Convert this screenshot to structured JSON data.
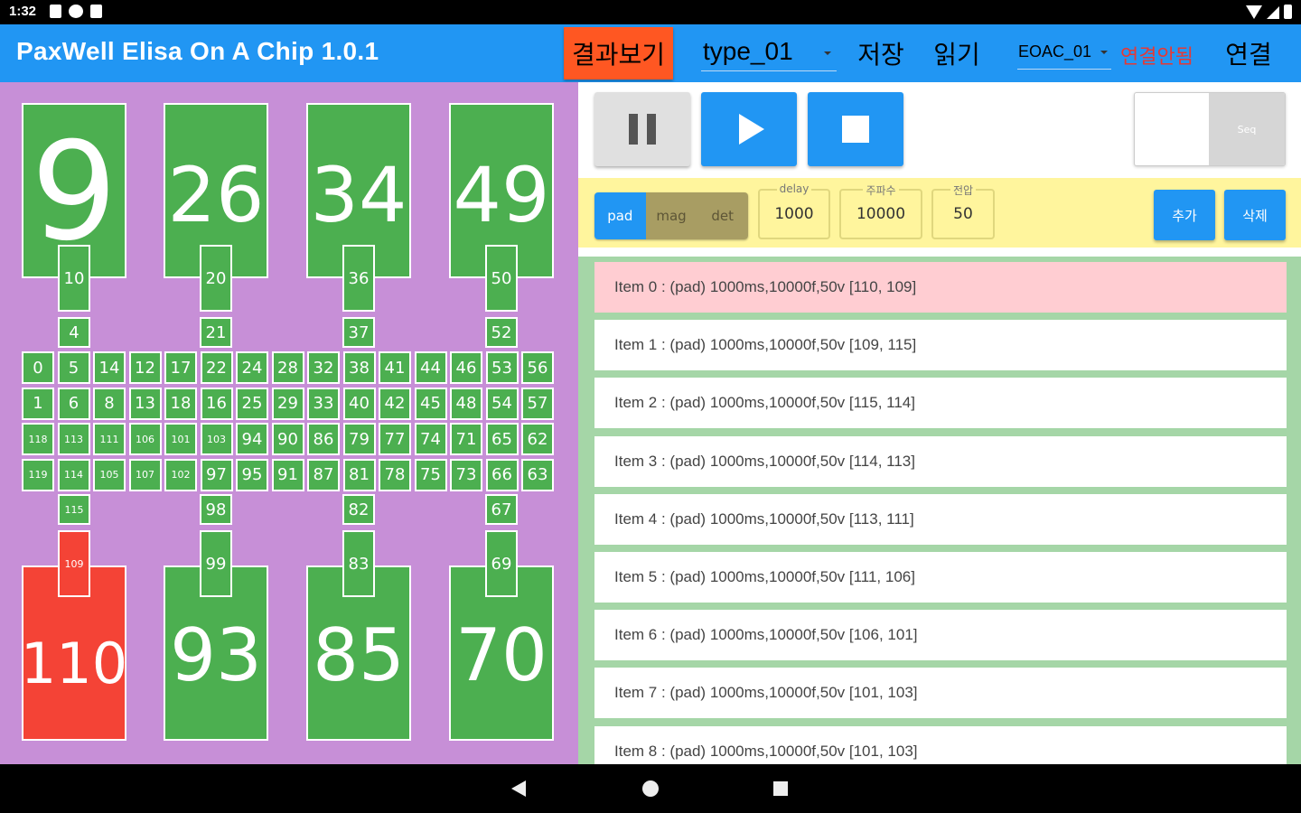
{
  "status_bar": {
    "time": "1:32"
  },
  "app_bar": {
    "title": "PaxWell Elisa On A Chip 1.0.1",
    "result_button": "결과보기",
    "type_value": "type_01",
    "save_button": "저장",
    "read_button": "읽기",
    "device_value": "EOAC_01",
    "connection_status": "연결안됨",
    "connect_button": "연결"
  },
  "chip": {
    "top_pads": [
      {
        "label": "9",
        "state": "on"
      },
      {
        "label": "26",
        "state": "on"
      },
      {
        "label": "34",
        "state": "on"
      },
      {
        "label": "49",
        "state": "on"
      }
    ],
    "bottom_pads": [
      {
        "label": "110",
        "state": "active"
      },
      {
        "label": "93",
        "state": "on"
      },
      {
        "label": "85",
        "state": "on"
      },
      {
        "label": "70",
        "state": "on"
      }
    ],
    "top_connectors": [
      [
        "10",
        "4"
      ],
      [
        "20",
        "21"
      ],
      [
        "36",
        "37"
      ],
      [
        "50",
        "52"
      ]
    ],
    "bottom_connectors": [
      [
        "115",
        "109"
      ],
      [
        "98",
        "99"
      ],
      [
        "82",
        "83"
      ],
      [
        "67",
        "69"
      ]
    ],
    "grid": [
      [
        "0",
        "5",
        "14",
        "12",
        "17",
        "22",
        "24",
        "28",
        "32",
        "38",
        "41",
        "44",
        "46",
        "53",
        "56"
      ],
      [
        "1",
        "6",
        "8",
        "13",
        "18",
        "16",
        "25",
        "29",
        "33",
        "40",
        "42",
        "45",
        "48",
        "54",
        "57"
      ],
      [
        "118",
        "113",
        "111",
        "106",
        "101",
        "103",
        "94",
        "90",
        "86",
        "79",
        "77",
        "74",
        "71",
        "65",
        "62"
      ],
      [
        "119",
        "114",
        "105",
        "107",
        "102",
        "97",
        "95",
        "91",
        "87",
        "81",
        "78",
        "75",
        "73",
        "66",
        "63"
      ]
    ],
    "active_cells": [
      "109",
      "110"
    ],
    "colors": {
      "on": "#4caf50",
      "active": "#f44336",
      "background": "#c78fd7"
    }
  },
  "controls": {
    "pause_icon": "pause-icon",
    "play_icon": "play-icon",
    "stop_icon": "stop-icon",
    "seq_toggle_label": "Seq"
  },
  "params": {
    "modes": [
      "pad",
      "mag",
      "det"
    ],
    "active_mode": "pad",
    "delay_label": "delay",
    "delay_value": "1000",
    "freq_label": "주파수",
    "freq_value": "10000",
    "volt_label": "전압",
    "volt_value": "50",
    "add_button": "추가",
    "delete_button": "삭제"
  },
  "items": [
    "Item 0 : (pad) 1000ms,10000f,50v  [110, 109]",
    "Item 1 : (pad) 1000ms,10000f,50v  [109, 115]",
    "Item 2 : (pad) 1000ms,10000f,50v  [115, 114]",
    "Item 3 : (pad) 1000ms,10000f,50v  [114, 113]",
    "Item 4 : (pad) 1000ms,10000f,50v  [113, 111]",
    "Item 5 : (pad) 1000ms,10000f,50v  [111, 106]",
    "Item 6 : (pad) 1000ms,10000f,50v  [106, 101]",
    "Item 7 : (pad) 1000ms,10000f,50v  [101, 103]",
    "Item 8 : (pad) 1000ms,10000f,50v  [101, 103]"
  ],
  "selected_item": 0,
  "colors": {
    "primary": "#2196f3",
    "accent": "#ff5722",
    "error": "#e53935",
    "param_bg": "#fff59d",
    "list_bg": "#a5d6a7",
    "selected_bg": "#ffcdd2"
  }
}
